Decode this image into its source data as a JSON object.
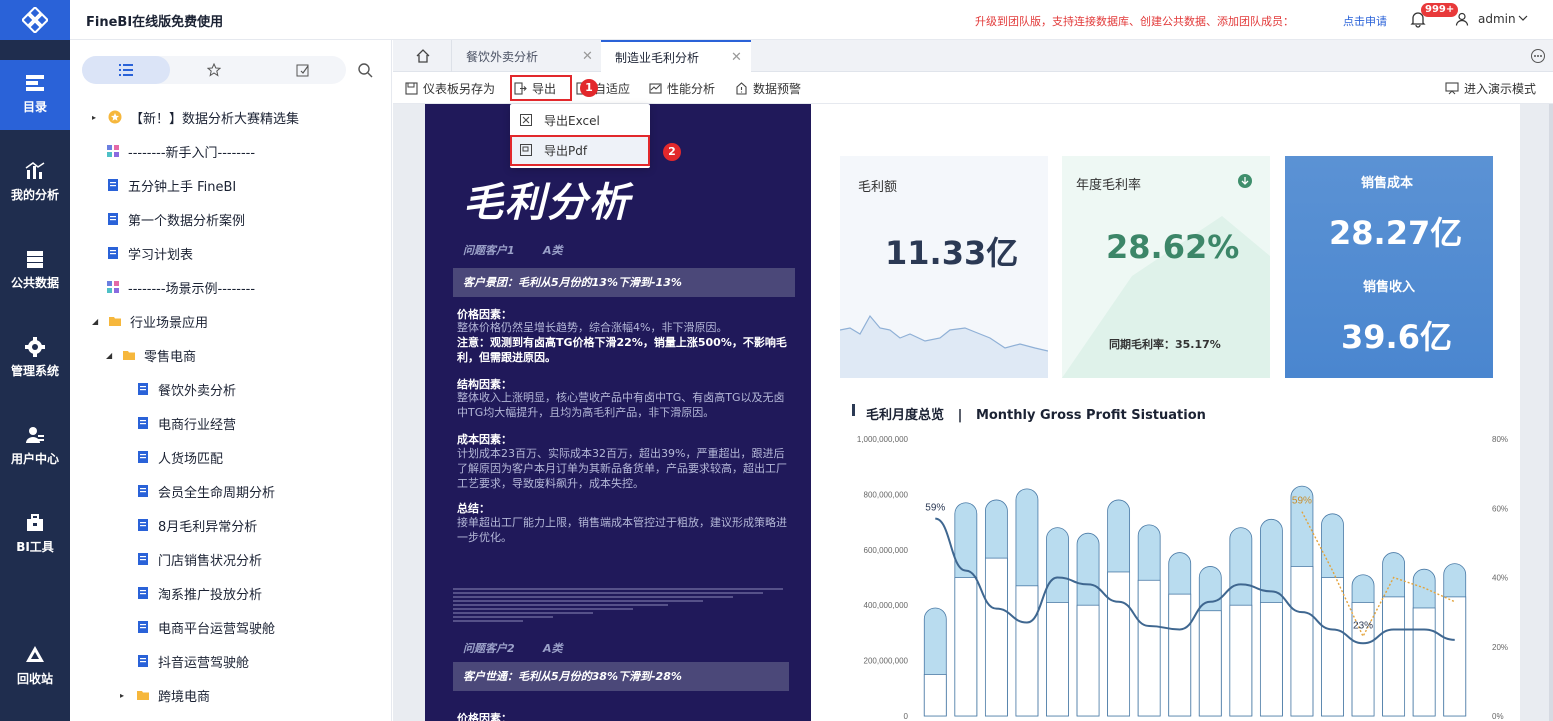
{
  "app": {
    "title": "FineBI在线版免费使用",
    "promo": "升级到团队版，支持连接数据库、创建公共数据、添加团队成员：",
    "apply_link": "点击申请",
    "notify_badge": "999+",
    "user": "admin"
  },
  "leftnav": [
    {
      "label": "目录",
      "icon": "catalog-icon",
      "active": true
    },
    {
      "label": "我的分析",
      "icon": "analysis-icon"
    },
    {
      "label": "公共数据",
      "icon": "database-icon"
    },
    {
      "label": "管理系统",
      "icon": "gear-icon"
    },
    {
      "label": "用户中心",
      "icon": "user-center-icon"
    },
    {
      "label": "BI工具",
      "icon": "toolbox-icon"
    },
    {
      "label": "回收站",
      "icon": "recycle-icon"
    }
  ],
  "tree": {
    "items": [
      {
        "label": "【新！】数据分析大赛精选集",
        "type": "star-folder",
        "caret": "▸"
      },
      {
        "label": "--------新手入门--------",
        "type": "group"
      },
      {
        "label": "五分钟上手 FineBI",
        "type": "doc"
      },
      {
        "label": "第一个数据分析案例",
        "type": "doc"
      },
      {
        "label": "学习计划表",
        "type": "doc"
      },
      {
        "label": "--------场景示例--------",
        "type": "group"
      },
      {
        "label": "行业场景应用",
        "type": "folder",
        "caret": "◢"
      },
      {
        "label": "零售电商",
        "type": "folder",
        "caret": "◢"
      },
      {
        "label": "餐饮外卖分析",
        "type": "doc"
      },
      {
        "label": "电商行业经营",
        "type": "doc"
      },
      {
        "label": "人货场匹配",
        "type": "doc"
      },
      {
        "label": "会员全生命周期分析",
        "type": "doc"
      },
      {
        "label": "8月毛利异常分析",
        "type": "doc"
      },
      {
        "label": "门店销售状况分析",
        "type": "doc"
      },
      {
        "label": "淘系推广投放分析",
        "type": "doc"
      },
      {
        "label": "电商平台运营驾驶舱",
        "type": "doc"
      },
      {
        "label": "抖音运营驾驶舱",
        "type": "doc"
      },
      {
        "label": "跨境电商",
        "type": "folder",
        "caret": "▸"
      }
    ]
  },
  "tabs": [
    {
      "label": "餐饮外卖分析"
    },
    {
      "label": "制造业毛利分析",
      "active": true
    }
  ],
  "toolbar": {
    "save_as": "仪表板另存为",
    "export": "导出",
    "adapt": "自适应",
    "perf": "性能分析",
    "alert": "数据预警",
    "present": "进入演示模式"
  },
  "export_menu": {
    "excel": "导出Excel",
    "pdf": "导出Pdf"
  },
  "steps": [
    "1",
    "2"
  ],
  "dashboard": {
    "title": "毛利分析",
    "customer1_tag": "问题客户1",
    "customer1_grade": "A类",
    "customer1_banner": "客户景团：毛利从5月份的13%下滑到-13%",
    "price_h": "价格因素：",
    "price_t": "整体价格仍然呈增长趋势，综合涨幅4%，非下滑原因。",
    "note": "注意：观测到有卤高TG价格下滑22%，销量上涨500%，不影响毛利，但需跟进原因。",
    "struct_h": "结构因素：",
    "struct_t": "整体收入上涨明显，核心营收产品中有卤中TG、有卤高TG以及无卤中TG均大幅提升，且均为高毛利产品，非下滑原因。",
    "cost_h": "成本因素：",
    "cost_t": "计划成本23百万、实际成本32百万，超出39%，严重超出，跟进后了解原因为客户本月订单为其新品备货单，产品要求较高，超出工厂工艺要求，导致废料飙升，成本失控。",
    "sum_h": "总结：",
    "sum_t": "接单超出工厂能力上限，销售端成本管控过于粗放，建议形成策略进一步优化。",
    "customer2_tag": "问题客户2",
    "customer2_grade": "A类",
    "customer2_banner": "客户世通：毛利从5月份的38%下滑到-28%",
    "price2_h": "价格因素：",
    "kpi_gross_label": "毛利额",
    "kpi_gross_value": "11.33亿",
    "kpi_rate_label": "年度毛利率",
    "kpi_rate_value": "28.62%",
    "kpi_rate_prev": "同期毛利率：35.17%",
    "kpi_cost_label": "销售成本",
    "kpi_cost_value": "28.27亿",
    "kpi_rev_label": "销售收入",
    "kpi_rev_value": "39.6亿",
    "chart_title": "毛利月度总览",
    "chart_title_en": "Monthly Gross Profit Sistuation"
  },
  "chart_data": {
    "type": "bar",
    "title": "毛利月度总览 | Monthly Gross Profit Sistuation",
    "ylim": [
      0,
      1000000000
    ],
    "y2lim": [
      0,
      80
    ],
    "y_ticks": [
      "0",
      "200,000,000",
      "400,000,000",
      "600,000,000",
      "800,000,000",
      "1,000,000,000"
    ],
    "y2_ticks": [
      "0%",
      "20%",
      "40%",
      "60%",
      "80%"
    ],
    "series": [
      {
        "kind": "bar-total",
        "values": [
          390000000,
          770000000,
          780000000,
          820000000,
          680000000,
          660000000,
          780000000,
          690000000,
          590000000,
          540000000,
          680000000,
          710000000,
          830000000,
          730000000,
          510000000,
          590000000,
          530000000,
          550000000
        ]
      },
      {
        "kind": "bar-inner",
        "values": [
          150000000,
          500000000,
          570000000,
          470000000,
          410000000,
          400000000,
          520000000,
          490000000,
          440000000,
          380000000,
          400000000,
          410000000,
          540000000,
          500000000,
          410000000,
          430000000,
          390000000,
          430000000
        ]
      },
      {
        "kind": "line-smooth",
        "values": [
          57,
          42,
          31,
          27,
          40,
          38,
          33,
          26,
          25,
          33,
          38,
          36,
          30,
          25,
          21,
          25,
          25,
          22
        ]
      },
      {
        "kind": "line-dotted",
        "values": [
          null,
          null,
          null,
          null,
          null,
          null,
          null,
          null,
          null,
          null,
          null,
          null,
          59,
          42,
          23,
          40,
          37,
          33
        ]
      }
    ],
    "labels": [
      "59%",
      "59%",
      "23%"
    ]
  }
}
